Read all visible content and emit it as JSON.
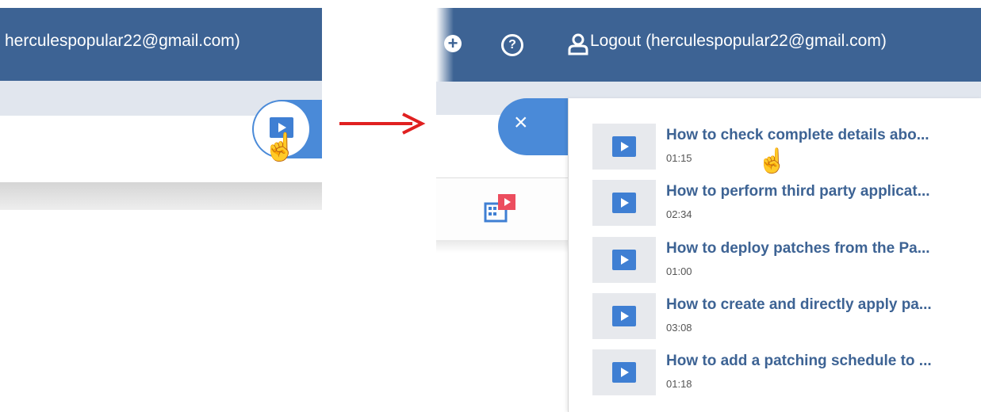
{
  "left": {
    "email": "herculespopular22@gmail.com)",
    "video_button_icon": "video-icon",
    "pointer_icon": "hand-pointer-icon"
  },
  "right": {
    "header": {
      "add_icon": "add-circle-icon",
      "help_icon": "help-circle-icon",
      "user_icon": "user-icon",
      "logout_label": "Logout (herculespopular22@gmail.com)"
    },
    "close_label": "×",
    "videos": [
      {
        "title": "How to check complete details abo...",
        "duration": "01:15"
      },
      {
        "title": "How to perform third party applicat...",
        "duration": "02:34"
      },
      {
        "title": "How to deploy patches from the Pa...",
        "duration": "01:00"
      },
      {
        "title": "How to create and directly apply pa...",
        "duration": "03:08"
      },
      {
        "title": "How to add a patching schedule to ...",
        "duration": "01:18"
      }
    ]
  },
  "colors": {
    "header": "#3d6394",
    "subbar": "#e1e6ee",
    "accent": "#4a8ad8",
    "arrow": "#e02020",
    "link": "#3d6394"
  }
}
